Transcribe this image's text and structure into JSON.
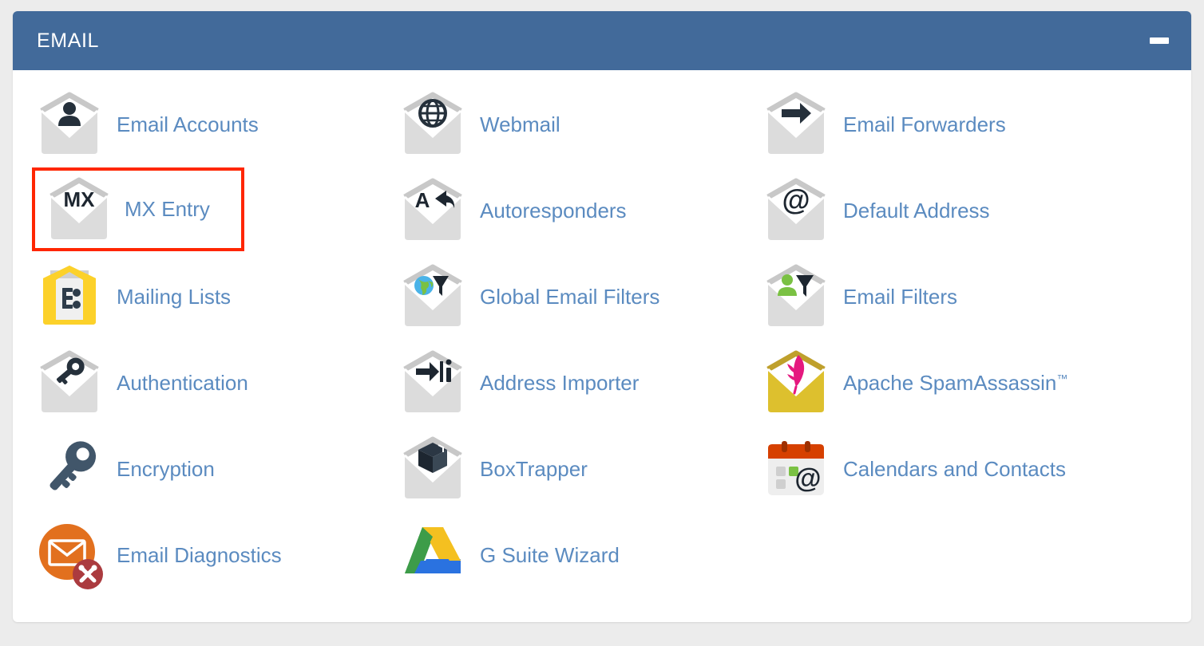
{
  "panel": {
    "title": "EMAIL",
    "minimize_label": "–",
    "header_color": "#426a9a",
    "background_color": "#ffffff",
    "page_background_color": "#ececec",
    "link_color": "#5b8bc0",
    "highlight_color": "#ff2600"
  },
  "items": [
    {
      "id": "email-accounts",
      "label": "Email Accounts",
      "icon": "envelope-person-icon",
      "highlighted": false
    },
    {
      "id": "webmail",
      "label": "Webmail",
      "icon": "envelope-globe-icon",
      "highlighted": false
    },
    {
      "id": "email-forwarders",
      "label": "Email Forwarders",
      "icon": "envelope-arrow-right-icon",
      "highlighted": false
    },
    {
      "id": "mx-entry",
      "label": "MX Entry",
      "icon": "envelope-mx-icon",
      "highlighted": true
    },
    {
      "id": "autoresponders",
      "label": "Autoresponders",
      "icon": "envelope-a-reply-icon",
      "highlighted": false
    },
    {
      "id": "default-address",
      "label": "Default Address",
      "icon": "envelope-at-icon",
      "highlighted": false
    },
    {
      "id": "mailing-lists",
      "label": "Mailing Lists",
      "icon": "yellow-envelope-list-icon",
      "highlighted": false
    },
    {
      "id": "global-email-filters",
      "label": "Global Email Filters",
      "icon": "envelope-globe-funnel-icon",
      "highlighted": false
    },
    {
      "id": "email-filters",
      "label": "Email Filters",
      "icon": "envelope-person-funnel-icon",
      "highlighted": false
    },
    {
      "id": "authentication",
      "label": "Authentication",
      "icon": "envelope-key-icon",
      "highlighted": false
    },
    {
      "id": "address-importer",
      "label": "Address Importer",
      "icon": "envelope-import-icon",
      "highlighted": false
    },
    {
      "id": "apache-spamassassin",
      "label": "Apache SpamAssassin",
      "label_suffix": "™",
      "icon": "gold-envelope-feather-icon",
      "highlighted": false
    },
    {
      "id": "encryption",
      "label": "Encryption",
      "icon": "key-icon",
      "highlighted": false
    },
    {
      "id": "boxtrapper",
      "label": "BoxTrapper",
      "icon": "envelope-cube-icon",
      "highlighted": false
    },
    {
      "id": "calendars-and-contacts",
      "label": "Calendars and Contacts",
      "icon": "calendar-at-icon",
      "highlighted": false
    },
    {
      "id": "email-diagnostics",
      "label": "Email Diagnostics",
      "icon": "orange-envelope-tools-icon",
      "highlighted": false
    },
    {
      "id": "g-suite-wizard",
      "label": "G Suite Wizard",
      "icon": "google-drive-icon",
      "highlighted": false
    }
  ]
}
